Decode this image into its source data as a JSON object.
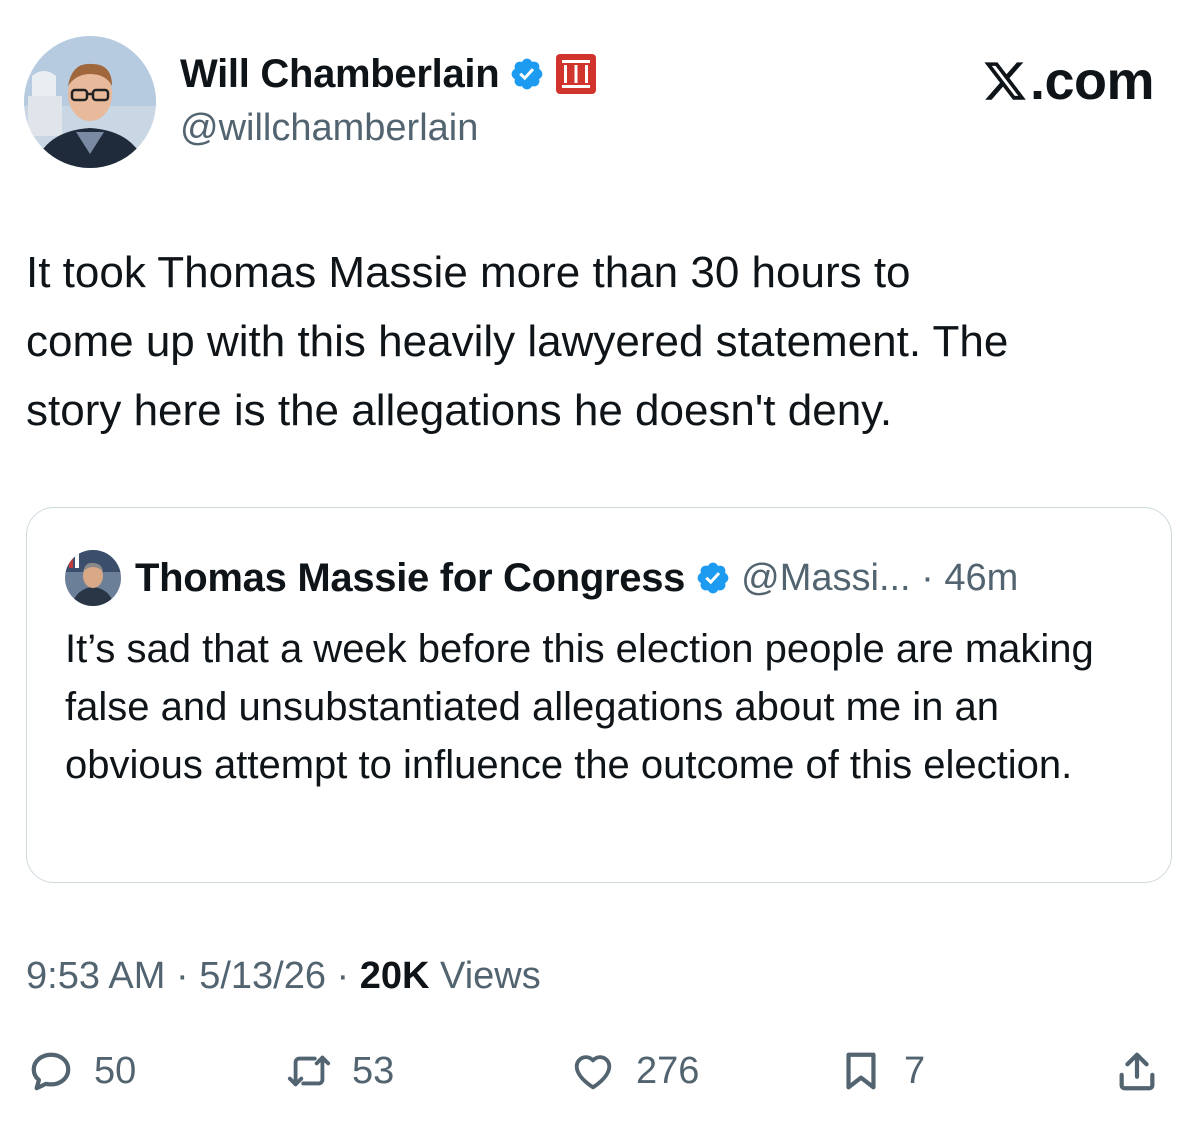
{
  "author": {
    "display_name": "Will Chamberlain",
    "handle": "@willchamberlain",
    "avatar_icon": "user-avatar-photo",
    "verified_icon": "verified-badge-icon",
    "affiliation_icon": "affiliation-badge-icon"
  },
  "site": {
    "label": ".com",
    "logo_icon": "x-logo-icon"
  },
  "tweet": {
    "text": "It took Thomas Massie more than 30 hours to\ncome up with this heavily lawyered statement. The\nstory here is the allegations he doesn't deny."
  },
  "quote": {
    "display_name": "Thomas Massie for Congress",
    "handle_time": "@Massi... · 46m",
    "text": "It’s sad that a week before this election people are making false and unsubstantiated allegations about me in an obvious attempt to influence the outcome of this election."
  },
  "meta": {
    "time": "9:53 AM",
    "sep1": " · ",
    "date": "5/13/26",
    "sep2": " · ",
    "views_count": "20K",
    "views_label": " Views"
  },
  "actions": {
    "replies": "50",
    "reposts": "53",
    "likes": "276",
    "bookmarks": "7"
  },
  "colors": {
    "text_primary": "#0f1419",
    "text_secondary": "#536471",
    "verified_blue": "#1d9bf0",
    "affiliation_red": "#d0342c",
    "border": "#cfd9de"
  }
}
